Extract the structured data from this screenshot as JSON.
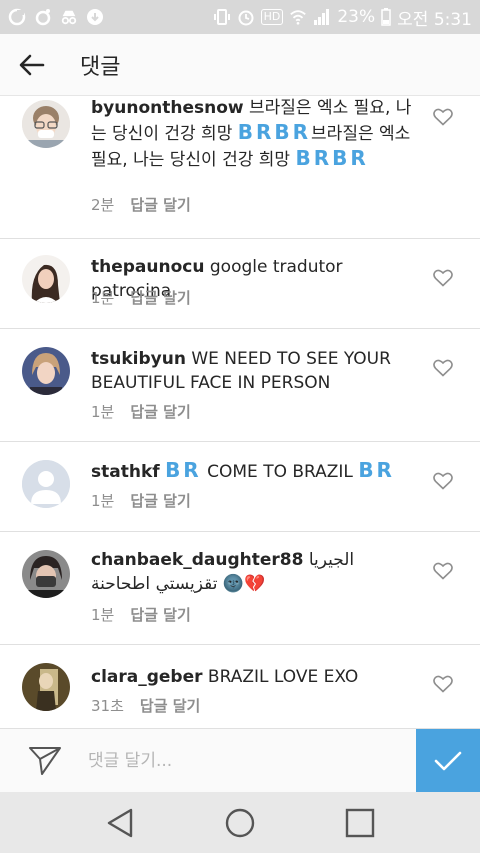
{
  "status_bar": {
    "battery": "23%",
    "time": "오전 5:31",
    "hd_label": "HD"
  },
  "header": {
    "title": "댓글"
  },
  "comments": [
    {
      "username": "byunonthesnow",
      "text_part1": "브라질은 엑소 필요, 나는 당신이 건강 희망",
      "flags1": "BRBR",
      "text_part2": "브라질은 엑소 필요, 나는 당신이 건강 희망",
      "flags2": "BRBR",
      "time": "2분",
      "reply": "답글 달기"
    },
    {
      "username": "thepaunocu",
      "text": "google tradutor patrocina",
      "time": "1분",
      "reply": "답글 달기"
    },
    {
      "username": "tsukibyun",
      "text": "WE NEED TO SEE YOUR BEAUTIFUL FACE IN PERSON",
      "time": "1분",
      "reply": "답글 달기"
    },
    {
      "username": "stathkf",
      "flags_before": "BR",
      "text": "COME TO BRAZIL",
      "flags_after": "BR",
      "time": "1분",
      "reply": "답글 달기"
    },
    {
      "username": "chanbaek_daughter88",
      "text": "الجيريا تقزيستي اطحاحنة",
      "emoji": "🌚💔",
      "time": "1분",
      "reply": "답글 달기"
    },
    {
      "username": "clara_geber",
      "text": "BRAZIL LOVE EXO",
      "time": "31초",
      "reply": "답글 달기"
    }
  ],
  "composer": {
    "placeholder": "댓글 달기..."
  },
  "colors": {
    "accent": "#4aa3df",
    "status_bar": "#d8d8d8",
    "nav_bar": "#e8e8e8"
  }
}
